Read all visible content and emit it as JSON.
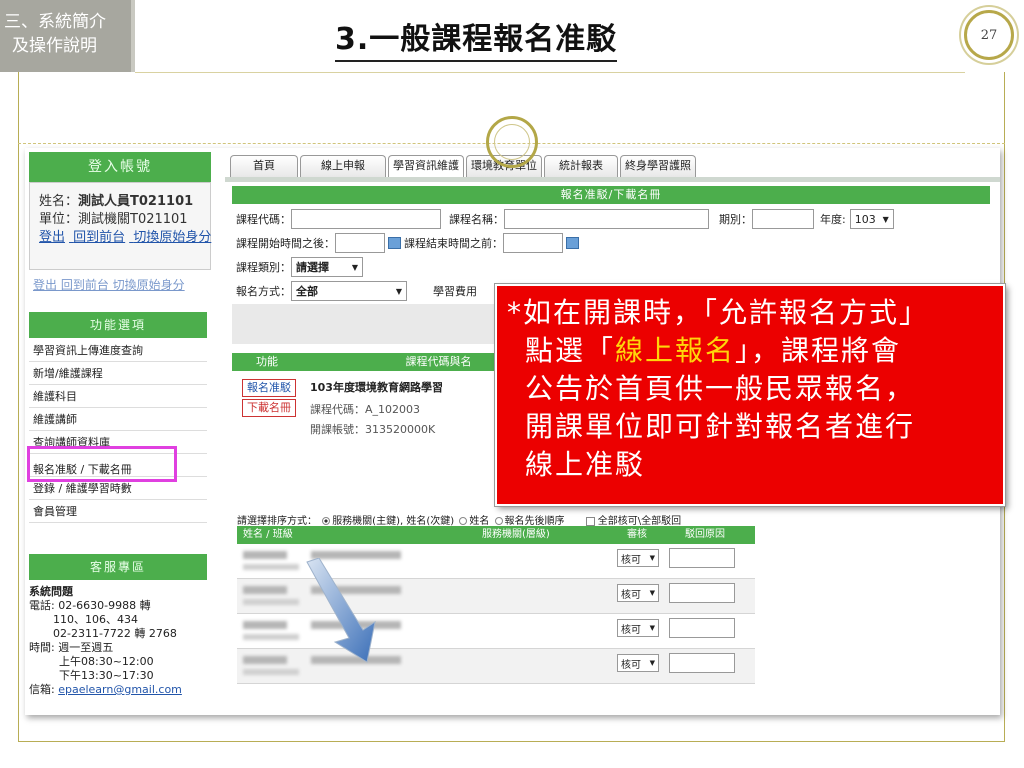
{
  "slide": {
    "section_line1": "三、系統簡介",
    "section_line2": "及操作說明",
    "title": "3.一般課程報名准駁",
    "page_number": "27"
  },
  "tabs": [
    "首頁",
    "線上申報",
    "學習資訊維護",
    "環境教育單位",
    "統計報表",
    "終身學習護照"
  ],
  "sidebar": {
    "login_header": "登入帳號",
    "name_label": "姓名：",
    "name_value": "測試人員T021101",
    "unit_label": "單位：",
    "unit_value": "測試機關T021101",
    "links": [
      "登出",
      "回到前台",
      "切換原始身分"
    ],
    "ghost_links": "登出  回到前台  切換原始身分",
    "function_header": "功能選項",
    "menu": [
      "學習資訊上傳進度查詢",
      "新增/維護課程",
      "維護科目",
      "維護講師",
      "查詢講師資料庫",
      "報名准駁 / 下載名冊",
      "登錄 / 維護學習時數",
      "會員管理"
    ],
    "service_header": "客服專區",
    "service": {
      "title": "系統問題",
      "phone_label": "電話: 02-6630-9988 轉",
      "phone_ext": "110、106、434",
      "phone2": "02-2311-7722 轉 2768",
      "time_label": "時間: 週一至週五",
      "morning": "上午08:30~12:00",
      "afternoon": "下午13:30~17:30",
      "mail_label": "信箱:",
      "mail": "epaelearn@gmail.com"
    }
  },
  "form": {
    "header": "報名准駁/下載名冊",
    "course_code_label": "課程代碼：",
    "course_name_label": "課程名稱：",
    "period_label": "期別：",
    "year_label": "年度:",
    "year_value": "103",
    "start_after_label": "課程開始時間之後：",
    "end_before_label": "課程結束時間之前：",
    "category_label": "課程類別：",
    "category_value": "請選擇",
    "method_label": "報名方式：",
    "method_value": "全部",
    "fee_label": "學習費用"
  },
  "list": {
    "col_function": "功能",
    "col_course": "課程代碼與名",
    "btn_approve": "報名准駁",
    "btn_download": "下載名冊",
    "course_title": "103年度環境教育網路學習",
    "course_code": "課程代碼：A_102003",
    "account": "開課帳號：313520000K"
  },
  "table": {
    "sort_label": "請選擇排序方式：",
    "sort_options": [
      "服務機關(主鍵), 姓名(次鍵)",
      "姓名",
      "報名先後順序"
    ],
    "check_all": "全部核可\\全部駁回",
    "headers": [
      "姓名 / 班級",
      "服務機關(層級)",
      "審核",
      "駁回原因"
    ],
    "row_select": "核可",
    "rows": 4
  },
  "note": {
    "line1_a": "*如在開課時，「允許報名方式」",
    "line2_a": "點選「",
    "line2_hl": "線上報名",
    "line2_b": "」，課程將會",
    "line3": "公告於首頁供一般民眾報名，",
    "line4": "開課單位即可針對報名者進行",
    "line5": "線上准駁"
  },
  "colors": {
    "green_header": "#4cae4c",
    "note_red": "#ec0000",
    "note_highlight": "#ffd60a",
    "menu_highlight": "#e040e0"
  }
}
